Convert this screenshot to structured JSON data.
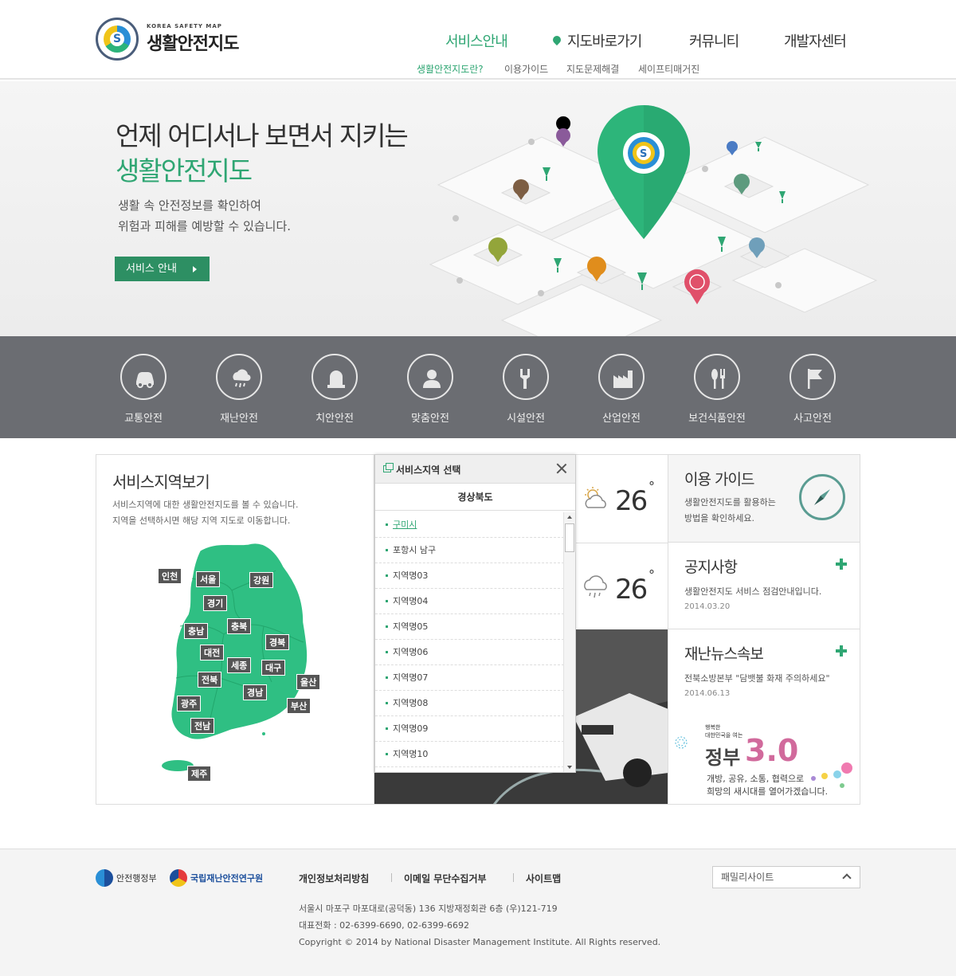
{
  "header": {
    "logo_sub": "KOREA SAFETY MAP",
    "logo_title": "생활안전지도",
    "nav": [
      {
        "label": "서비스안내"
      },
      {
        "label": "지도바로가기"
      },
      {
        "label": "커뮤니티"
      },
      {
        "label": "개발자센터"
      }
    ],
    "subnav": [
      {
        "label": "생활안전지도란?"
      },
      {
        "label": "이용가이드"
      },
      {
        "label": "지도문제해결"
      },
      {
        "label": "세이프티매거진"
      }
    ]
  },
  "hero": {
    "title_line1": "언제 어디서나 보면서 지키는",
    "title_line2": "생활안전지도",
    "desc_line1": "생활 속 안전정보를 확인하여",
    "desc_line2": "위험과 피해를 예방할 수 있습니다.",
    "button": "서비스 안내"
  },
  "categories": [
    {
      "label": "교통안전",
      "icon": "car-icon"
    },
    {
      "label": "재난안전",
      "icon": "cloud-rain-icon"
    },
    {
      "label": "치안안전",
      "icon": "siren-icon"
    },
    {
      "label": "맞춤안전",
      "icon": "person-icon"
    },
    {
      "label": "시설안전",
      "icon": "wrench-icon"
    },
    {
      "label": "산업안전",
      "icon": "factory-icon"
    },
    {
      "label": "보건식품안전",
      "icon": "utensils-icon"
    },
    {
      "label": "사고안전",
      "icon": "flag-icon"
    }
  ],
  "region": {
    "title": "서비스지역보기",
    "desc_line1": "서비스지역에 대한 생활안전지도를 볼 수 있습니다.",
    "desc_line2": "지역을 선택하시면 해당 지역 지도로 이동합니다.",
    "labels": [
      "인천",
      "서울",
      "강원",
      "경기",
      "충남",
      "충북",
      "경북",
      "대전",
      "세종",
      "대구",
      "전북",
      "울산",
      "경남",
      "광주",
      "부산",
      "전남",
      "제주"
    ]
  },
  "popup": {
    "title": "서비스지역 선택",
    "province": "경상북도",
    "items": [
      "구미시",
      "포항시 남구",
      "지역명03",
      "지역명04",
      "지역명05",
      "지역명06",
      "지역명07",
      "지역명08",
      "지역명09",
      "지역명10"
    ]
  },
  "weather": [
    {
      "temp": "26",
      "deg": "°",
      "icon": "partly-cloudy-icon"
    },
    {
      "temp": "26",
      "deg": "°",
      "icon": "rain-cloud-icon"
    }
  ],
  "guide": {
    "title": "이용 가이드",
    "desc_line1": "생활안전지도를 활용하는",
    "desc_line2": "방법을 확인하세요."
  },
  "notice": {
    "title": "공지사항",
    "text": "생활안전지도 서비스 점검안내입니다.",
    "date": "2014.03.20"
  },
  "news": {
    "title": "재난뉴스속보",
    "text": "전북소방본부 \"담뱃불 화재 주의하세요\"",
    "date": "2014.06.13"
  },
  "gov_banner": {
    "small_line1": "행복한",
    "small_line2": "대한민국을 여는",
    "big": "정부",
    "num": "3.0",
    "desc_line1": "개방, 공유, 소통, 협력으로",
    "desc_line2": "희망의 새시대를 열어가겠습니다."
  },
  "footer": {
    "org1": "안전행정부",
    "org2": "국립재난안전연구원",
    "links": [
      "개인정보처리방침",
      "이메일 무단수집거부",
      "사이트맵"
    ],
    "address": "서울시 마포구 마포대로(공덕동) 136 지방재정회관 6층 (우)121-719",
    "phone": "대표전화 : 02-6399-6690, 02-6399-6692",
    "copyright": "Copyright © 2014 by National Disaster Management Institute. All Rights reserved.",
    "family_site": "패밀리사이트"
  },
  "colors": {
    "accent": "#2fa673",
    "catbar": "#6b6d72",
    "button": "#2d8f63"
  }
}
